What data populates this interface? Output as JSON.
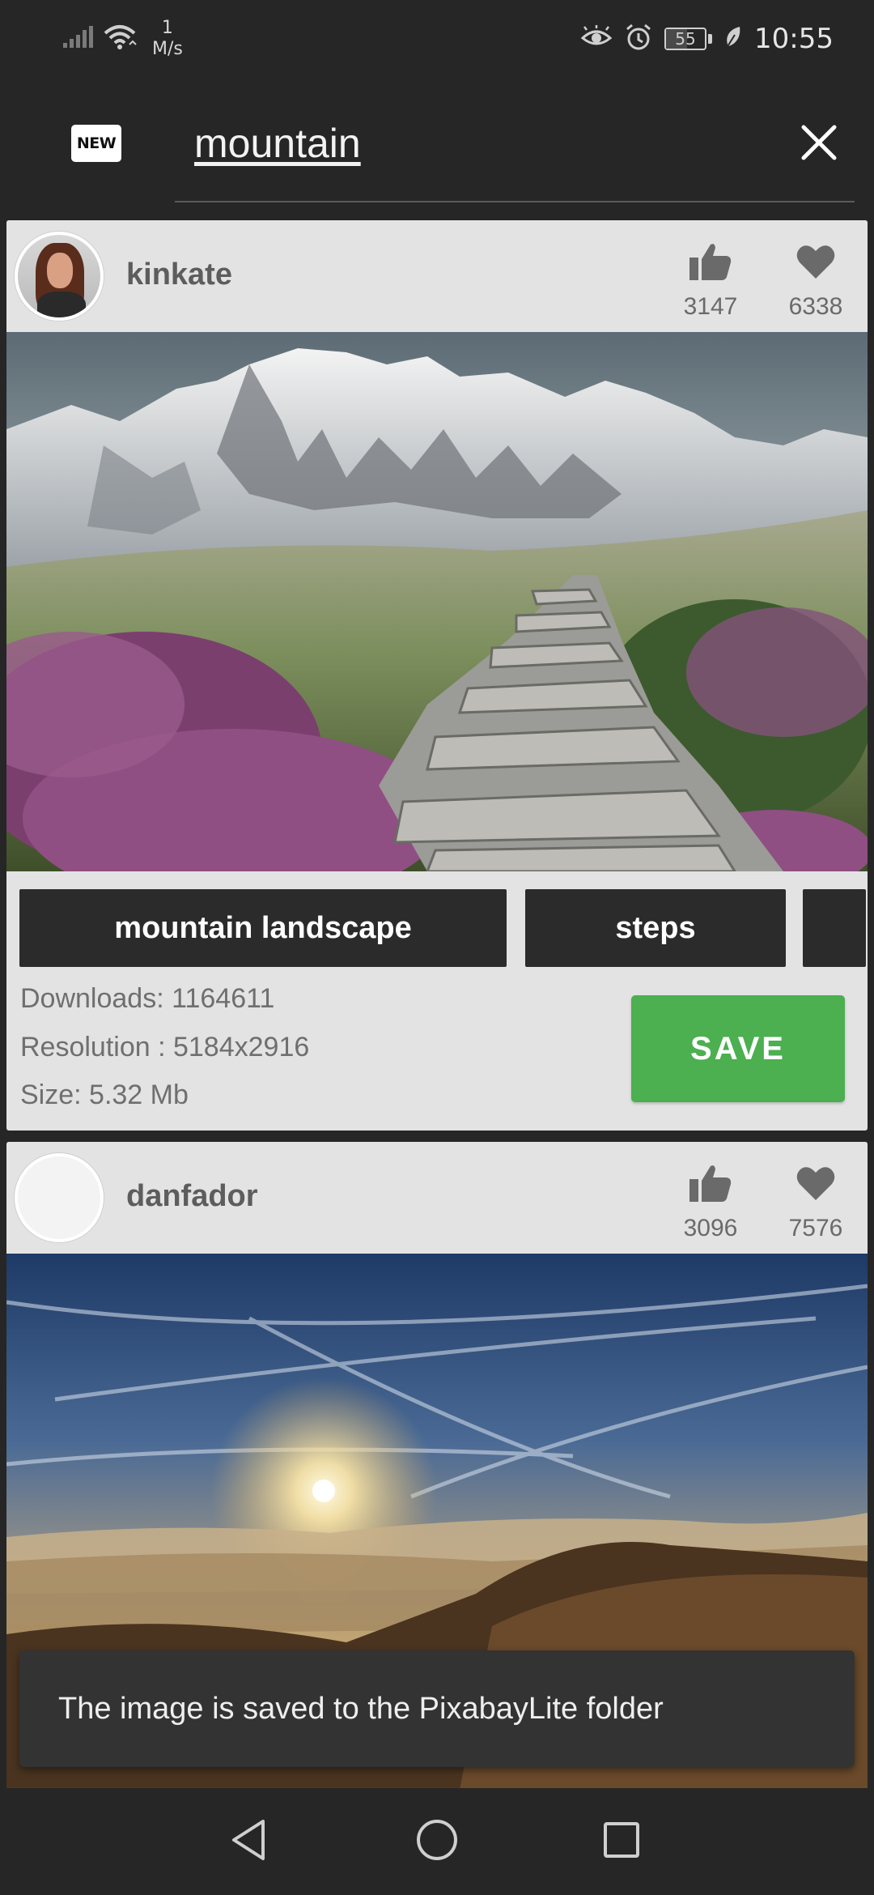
{
  "status_bar": {
    "speed_value": "1",
    "speed_unit": "M/s",
    "battery": "55",
    "battery_level": 0.55,
    "time": "10:55"
  },
  "search": {
    "query": "mountain",
    "new_badge": "NEW"
  },
  "posts": [
    {
      "user": "kinkate",
      "likes": "3147",
      "favorites": "6338",
      "tags": [
        "mountain landscape",
        "steps",
        ""
      ],
      "downloads": "Downloads: 1164611",
      "resolution": "Resolution : 5184x2916",
      "size": "Size: 5.32 Mb",
      "save_label": "SAVE"
    },
    {
      "user": "danfador",
      "likes": "3096",
      "favorites": "7576"
    }
  ],
  "snackbar": {
    "message": "The image is saved to the PixabayLite folder"
  },
  "colors": {
    "background": "#262626",
    "card": "#e3e3e3",
    "tag": "#2b2b2b",
    "save_button": "#4caf50"
  },
  "icons": {
    "signal": "signal-icon",
    "wifi": "wifi-icon",
    "eye": "eye-comfort-icon",
    "alarm": "alarm-icon",
    "leaf": "power-saving-icon",
    "close": "close-icon",
    "like": "thumb-up-icon",
    "favorite": "heart-icon",
    "back": "nav-back-icon",
    "home": "nav-home-icon",
    "recents": "nav-recents-icon"
  }
}
